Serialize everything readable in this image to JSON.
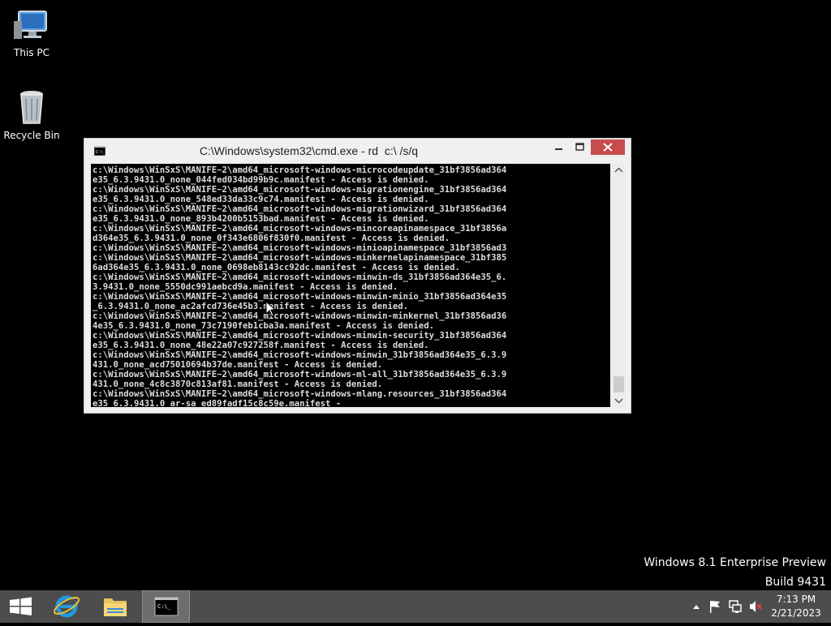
{
  "desktop": {
    "icons": [
      {
        "label": "This PC"
      },
      {
        "label": "Recycle Bin"
      }
    ],
    "watermark": {
      "line1": "Windows 8.1 Enterprise Preview",
      "line2": "Build 9431"
    }
  },
  "cmd_window": {
    "title": "C:\\Windows\\system32\\cmd.exe - rd  c:\\ /s/q",
    "console_lines": [
      "c:\\Windows\\WinSxS\\MANIFE~2\\amd64_microsoft-windows-microcodeupdate_31bf3856ad364",
      "e35_6.3.9431.0_none_044fed034bd99b9c.manifest - Access is denied.",
      "c:\\Windows\\WinSxS\\MANIFE~2\\amd64_microsoft-windows-migrationengine_31bf3856ad364",
      "e35_6.3.9431.0_none_548ed33da33c9c74.manifest - Access is denied.",
      "c:\\Windows\\WinSxS\\MANIFE~2\\amd64_microsoft-windows-migrationwizard_31bf3856ad364",
      "e35_6.3.9431.0_none_893b4200b5153bad.manifest - Access is denied.",
      "c:\\Windows\\WinSxS\\MANIFE~2\\amd64_microsoft-windows-mincoreapinamespace_31bf3856a",
      "d364e35_6.3.9431.0_none_0f343e6806f830f0.manifest - Access is denied.",
      "c:\\Windows\\WinSxS\\MANIFE~2\\amd64_microsoft-windows-minioapinamespace_31bf3856ad3",
      "c:\\Windows\\WinSxS\\MANIFE~2\\amd64_microsoft-windows-minkernelapinamespace_31bf385",
      "6ad364e35_6.3.9431.0_none_0698eb8143cc92dc.manifest - Access is denied.",
      "c:\\Windows\\WinSxS\\MANIFE~2\\amd64_microsoft-windows-minwin-ds_31bf3856ad364e35_6.",
      "3.9431.0_none_5550dc991aebcd9a.manifest - Access is denied.",
      "c:\\Windows\\WinSxS\\MANIFE~2\\amd64_microsoft-windows-minwin-minio_31bf3856ad364e35",
      "_6.3.9431.0_none_ac2afcd736e45b3.manifest - Access is denied.",
      "c:\\Windows\\WinSxS\\MANIFE~2\\amd64_microsoft-windows-minwin-minkernel_31bf3856ad36",
      "4e35_6.3.9431.0_none_73c7190feb1cba3a.manifest - Access is denied.",
      "c:\\Windows\\WinSxS\\MANIFE~2\\amd64_microsoft-windows-minwin-security_31bf3856ad364",
      "e35_6.3.9431.0_none_48e22a07c927258f.manifest - Access is denied.",
      "c:\\Windows\\WinSxS\\MANIFE~2\\amd64_microsoft-windows-minwin_31bf3856ad364e35_6.3.9",
      "431.0_none_acd75010694b37de.manifest - Access is denied.",
      "c:\\Windows\\WinSxS\\MANIFE~2\\amd64_microsoft-windows-ml-all_31bf3856ad364e35_6.3.9",
      "431.0_none_4c8c3870c813af81.manifest - Access is denied.",
      "c:\\Windows\\WinSxS\\MANIFE~2\\amd64_microsoft-windows-mlang.resources_31bf3856ad364",
      "e35_6.3.9431.0_ar-sa_ed89fadf15c8c59e.manifest -"
    ]
  },
  "taskbar": {
    "clock_time": "7:13 PM",
    "clock_date": "2/21/2023",
    "tray_icons": [
      "show-hidden-icons-arrow",
      "action-center-flag-icon",
      "network-icon",
      "volume-muted-icon"
    ],
    "pinned": [
      "start-button",
      "internet-explorer-icon",
      "file-explorer-icon",
      "command-prompt-icon"
    ]
  },
  "colors": {
    "taskbar": "#4d4d4d",
    "close_button": "#c74c4c",
    "desktop": "#000000"
  }
}
